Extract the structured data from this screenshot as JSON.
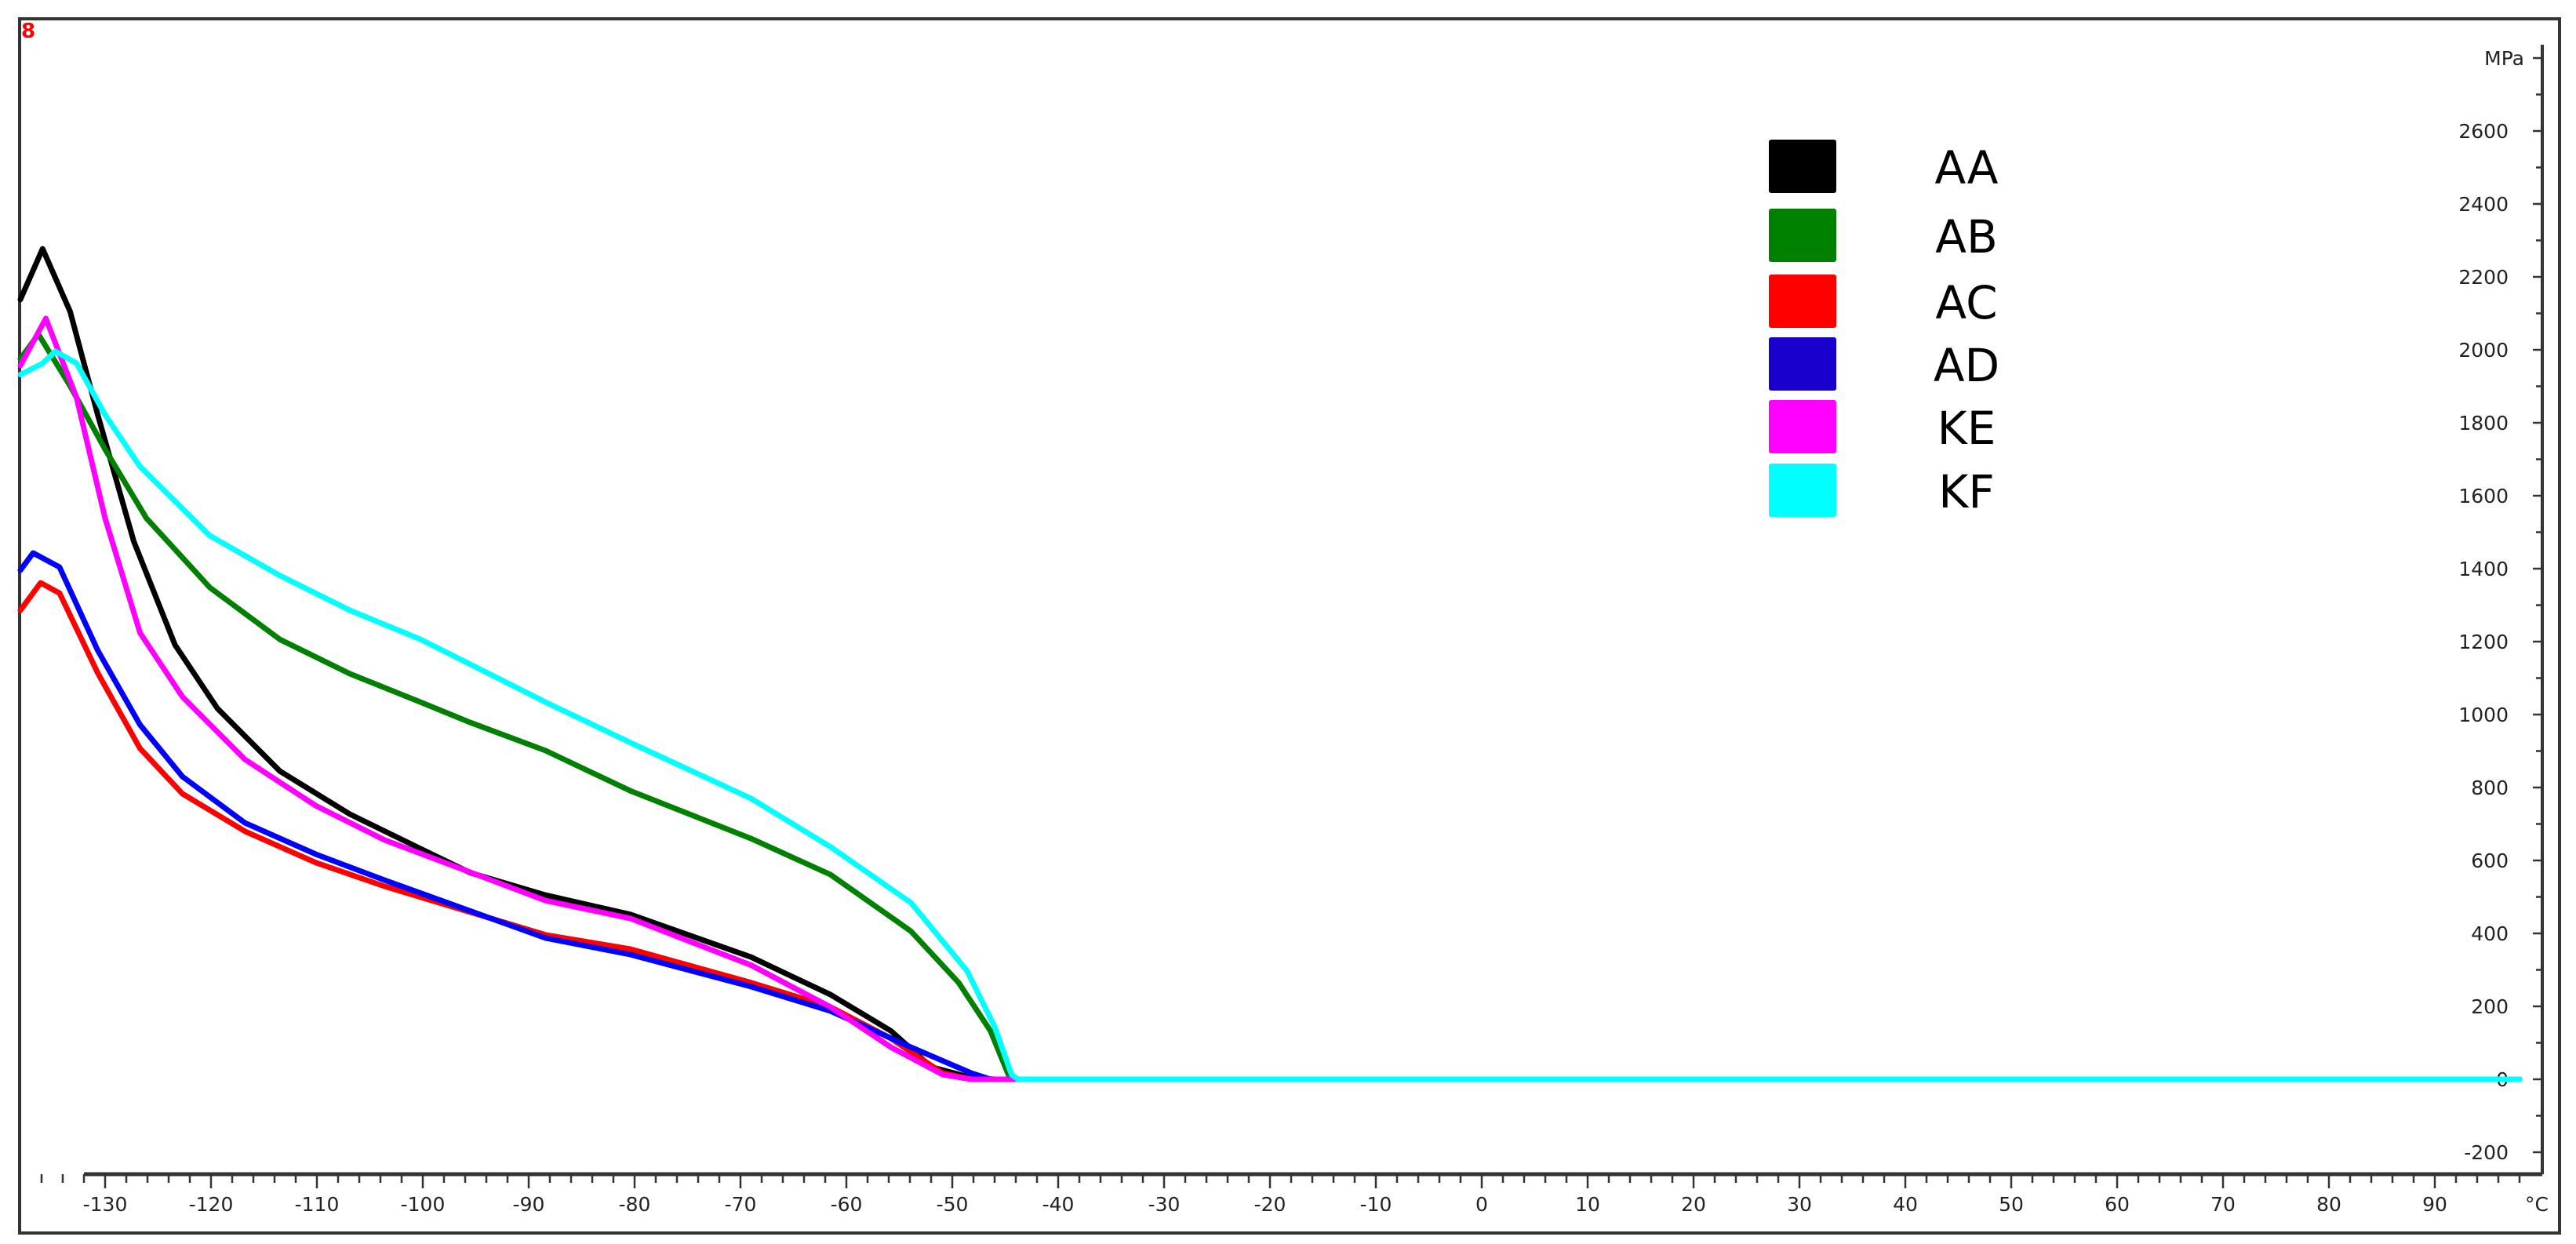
{
  "corner_marker": "8",
  "chart_data": {
    "type": "line",
    "title": "",
    "xlabel": "°C",
    "ylabel": "MPa",
    "xlim": [
      -138.2,
      100
    ],
    "ylim": [
      -256,
      2905
    ],
    "grid": false,
    "legend_position": "top-right",
    "x_ticks": [
      -130,
      -120,
      -110,
      -100,
      -90,
      -80,
      -70,
      -60,
      -50,
      -40,
      -30,
      -20,
      -10,
      0,
      10,
      20,
      30,
      40,
      50,
      60,
      70,
      80,
      90
    ],
    "x_tick_labels": [
      "-130",
      "-120",
      "-110",
      "-100",
      "-90",
      "-80",
      "-70",
      "-60",
      "-50",
      "-40",
      "-30",
      "-20",
      "-10",
      "0",
      "10",
      "20",
      "30",
      "40",
      "50",
      "60",
      "70",
      "80",
      "90"
    ],
    "x_unit_label": "°C",
    "y_ticks": [
      -200,
      0,
      200,
      400,
      600,
      800,
      1000,
      1200,
      1400,
      1600,
      1800,
      2000,
      2200,
      2400,
      2600
    ],
    "y_tick_labels": [
      "-200",
      "0",
      "200",
      "400",
      "600",
      "800",
      "1000",
      "1200",
      "1400",
      "1600",
      "1800",
      "2000",
      "2200",
      "2400",
      "2600"
    ],
    "y_unit_label": "MPa",
    "series": [
      {
        "name": "AA",
        "color": "#000000",
        "points": [
          [
            -138,
            2138
          ],
          [
            -135.9,
            2277
          ],
          [
            -133.3,
            2105
          ],
          [
            -130.7,
            1822
          ],
          [
            -127.3,
            1475
          ],
          [
            -123.4,
            1191
          ],
          [
            -119.4,
            1017
          ],
          [
            -113.5,
            845
          ],
          [
            -106.9,
            727
          ],
          [
            -100.2,
            632
          ],
          [
            -95.5,
            566
          ],
          [
            -88.4,
            505
          ],
          [
            -80.4,
            452
          ],
          [
            -69,
            335
          ],
          [
            -61.5,
            232
          ],
          [
            -55.8,
            133
          ],
          [
            -52,
            34
          ],
          [
            -48.2,
            4
          ],
          [
            -46,
            0
          ],
          [
            98,
            0
          ]
        ]
      },
      {
        "name": "AB",
        "color": "#008000",
        "points": [
          [
            -138,
            1975
          ],
          [
            -136.3,
            2043
          ],
          [
            -133.3,
            1901
          ],
          [
            -130,
            1727
          ],
          [
            -126.1,
            1538
          ],
          [
            -120.1,
            1348
          ],
          [
            -113.5,
            1206
          ],
          [
            -106.9,
            1112
          ],
          [
            -100.2,
            1034
          ],
          [
            -95.5,
            978
          ],
          [
            -88.4,
            901
          ],
          [
            -80.4,
            791
          ],
          [
            -69,
            660
          ],
          [
            -61.5,
            561
          ],
          [
            -53.9,
            406
          ],
          [
            -49.4,
            265
          ],
          [
            -46.4,
            133
          ],
          [
            -44.7,
            13
          ],
          [
            -44,
            0
          ],
          [
            98,
            0
          ]
        ]
      },
      {
        "name": "AC",
        "color": "#ff0000",
        "points": [
          [
            -138,
            1286
          ],
          [
            -136.1,
            1361
          ],
          [
            -134.3,
            1333
          ],
          [
            -130.7,
            1114
          ],
          [
            -126.7,
            907
          ],
          [
            -122.7,
            783
          ],
          [
            -116.8,
            680
          ],
          [
            -110.1,
            594
          ],
          [
            -103.6,
            529
          ],
          [
            -88.4,
            396
          ],
          [
            -80.4,
            357
          ],
          [
            -69,
            265
          ],
          [
            -61.5,
            198
          ],
          [
            -55.8,
            112
          ],
          [
            -50.9,
            17
          ],
          [
            -48.2,
            0
          ],
          [
            98,
            0
          ]
        ]
      },
      {
        "name": "AD",
        "color": "#0000ff",
        "points": [
          [
            -138,
            1396
          ],
          [
            -136.8,
            1443
          ],
          [
            -134.3,
            1404
          ],
          [
            -130.7,
            1176
          ],
          [
            -126.7,
            972
          ],
          [
            -122.7,
            830
          ],
          [
            -116.8,
            703
          ],
          [
            -110.1,
            617
          ],
          [
            -103.6,
            546
          ],
          [
            -88.4,
            387
          ],
          [
            -80.4,
            342
          ],
          [
            -69,
            254
          ],
          [
            -61.5,
            187
          ],
          [
            -53.9,
            88
          ],
          [
            -48.2,
            17
          ],
          [
            -46.4,
            0
          ],
          [
            98,
            0
          ]
        ]
      },
      {
        "name": "KE",
        "color": "#ff00ff",
        "points": [
          [
            -138,
            1957
          ],
          [
            -135.6,
            2086
          ],
          [
            -132.7,
            1869
          ],
          [
            -130,
            1538
          ],
          [
            -126.7,
            1224
          ],
          [
            -122.7,
            1049
          ],
          [
            -116.8,
            877
          ],
          [
            -110.1,
            750
          ],
          [
            -103.6,
            656
          ],
          [
            -88.4,
            490
          ],
          [
            -80.4,
            441
          ],
          [
            -69,
            313
          ],
          [
            -61.5,
            198
          ],
          [
            -55.8,
            88
          ],
          [
            -50.9,
            13
          ],
          [
            -48.2,
            0
          ],
          [
            98,
            0
          ]
        ]
      },
      {
        "name": "KF",
        "color": "#00ffff",
        "points": [
          [
            -138,
            1932
          ],
          [
            -135.9,
            1963
          ],
          [
            -134.7,
            1996
          ],
          [
            -132.7,
            1963
          ],
          [
            -130,
            1822
          ],
          [
            -126.7,
            1680
          ],
          [
            -120.1,
            1490
          ],
          [
            -113.5,
            1381
          ],
          [
            -106.9,
            1286
          ],
          [
            -100.2,
            1206
          ],
          [
            -88.4,
            1034
          ],
          [
            -80.4,
            923
          ],
          [
            -69,
            770
          ],
          [
            -61.5,
            637
          ],
          [
            -53.9,
            484
          ],
          [
            -48.6,
            297
          ],
          [
            -46,
            144
          ],
          [
            -44.4,
            13
          ],
          [
            -43.8,
            0
          ],
          [
            98,
            0
          ]
        ]
      }
    ],
    "legend": [
      {
        "label": "AA",
        "color": "#000000"
      },
      {
        "label": "AB",
        "color": "#008000"
      },
      {
        "label": "AC",
        "color": "#ff0000"
      },
      {
        "label": "AD",
        "color": "#1a00cc"
      },
      {
        "label": "KE",
        "color": "#ff00ff"
      },
      {
        "label": "KF",
        "color": "#00ffff"
      }
    ]
  }
}
